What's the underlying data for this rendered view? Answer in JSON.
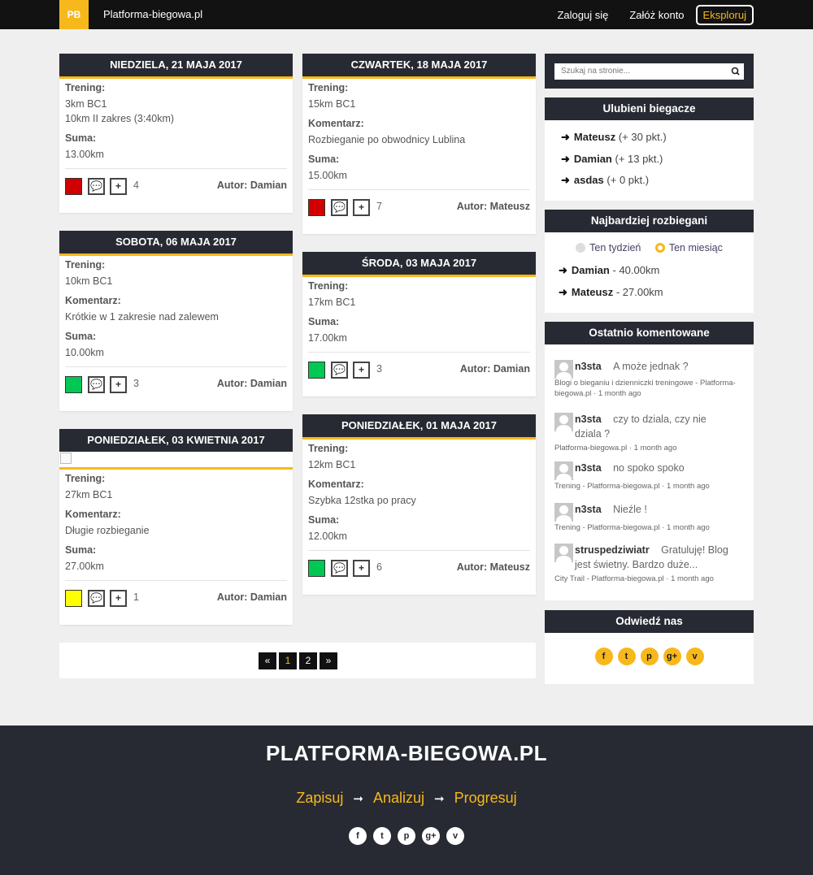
{
  "navbar": {
    "logo": "PB",
    "brand": "Platforma-biegowa.pl",
    "login": "Zaloguj się",
    "register": "Załóż konto",
    "explore": "Eksploruj"
  },
  "labels": {
    "training": "Trening:",
    "comment": "Komentarz:",
    "sum": "Suma:"
  },
  "cards": [
    {
      "date": "Niedziela, 21 maja 2017",
      "training": [
        "3km BC1",
        "10km II zakres (3:40km)"
      ],
      "sum": "13.00km",
      "count": "4",
      "author": "Autor: Damian",
      "status_color": "#d10000"
    },
    {
      "date": "Sobota, 06 maja 2017",
      "training": [
        "10km BC1"
      ],
      "comment": "Krótkie w 1 zakresie nad zalewem",
      "sum": "10.00km",
      "count": "3",
      "author": "Autor: Damian",
      "status_color": "#00c853"
    },
    {
      "date": "Poniedziałek, 03 kwietnia 2017",
      "training": [
        "27km BC1"
      ],
      "comment": "Długie rozbieganie",
      "sum": "27.00km",
      "count": "1",
      "author": "Autor: Damian",
      "status_color": "#ffff00"
    },
    {
      "date": "Czwartek, 18 maja 2017",
      "training": [
        "15km BC1"
      ],
      "comment": "Rozbieganie po obwodnicy Lublina",
      "sum": "15.00km",
      "count": "7",
      "author": "Autor: Mateusz",
      "status_color": "#d10000"
    },
    {
      "date": "Środa, 03 maja 2017",
      "training": [
        "17km BC1"
      ],
      "sum": "17.00km",
      "count": "3",
      "author": "Autor: Damian",
      "status_color": "#00c853"
    },
    {
      "date": "Poniedziałek, 01 maja 2017",
      "training": [
        "12km BC1"
      ],
      "comment": "Szybka 12stka po pracy",
      "sum": "12.00km",
      "count": "6",
      "author": "Autor: Mateusz",
      "status_color": "#00c853"
    }
  ],
  "pagination": {
    "prev": "«",
    "pages": [
      "1",
      "2"
    ],
    "current": "1",
    "next": "»"
  },
  "search": {
    "placeholder": "Szukaj na stronie..."
  },
  "favorites": {
    "title": "Ulubieni biegacze",
    "items": [
      {
        "name": "Mateusz",
        "points": "(+ 30 pkt.)"
      },
      {
        "name": "Damian",
        "points": "(+ 13 pkt.)"
      },
      {
        "name": "asdas",
        "points": "(+ 0 pkt.)"
      }
    ]
  },
  "most_run": {
    "title": "Najbardziej rozbiegani",
    "option_week": "Ten tydzień",
    "option_month": "Ten miesiąc",
    "selected": "Ten miesiąc",
    "items": [
      {
        "name": "Damian",
        "distance": "- 40.00km"
      },
      {
        "name": "Mateusz",
        "distance": "- 27.00km"
      }
    ]
  },
  "recent_comments": {
    "title": "Ostatnio komentowane",
    "items": [
      {
        "user": "n3sta",
        "text": "A może jednak ?",
        "meta": "Blogi o bieganiu i dzienniczki treningowe - Platforma-biegowa.pl · 1 month ago"
      },
      {
        "user": "n3sta",
        "text": "czy to dziala, czy nie dziala ?",
        "meta": "Platforma-biegowa.pl · 1 month ago"
      },
      {
        "user": "n3sta",
        "text": "no spoko spoko",
        "meta": "Trening - Platforma-biegowa.pl · 1 month ago"
      },
      {
        "user": "n3sta",
        "text": "Nieźle !",
        "meta": "Trening - Platforma-biegowa.pl · 1 month ago"
      },
      {
        "user": "struspedziwiatr",
        "text": "Gratuluję! Blog jest świetny. Bardzo duże...",
        "meta": "City Trail - Platforma-biegowa.pl · 1 month ago"
      }
    ]
  },
  "visit": {
    "title": "Odwiedź nas"
  },
  "social_icons": [
    "facebook-icon",
    "twitter-icon",
    "pinterest-icon",
    "google-plus-icon",
    "vimeo-icon"
  ],
  "footer": {
    "title": "PLATFORMA-BIEGOWA.PL",
    "step1": "Zapisuj",
    "step2": "Analizuj",
    "step3": "Progresuj"
  },
  "colors": {
    "accent": "#f7b81c",
    "dark": "#272a32",
    "navbar": "#121212"
  }
}
